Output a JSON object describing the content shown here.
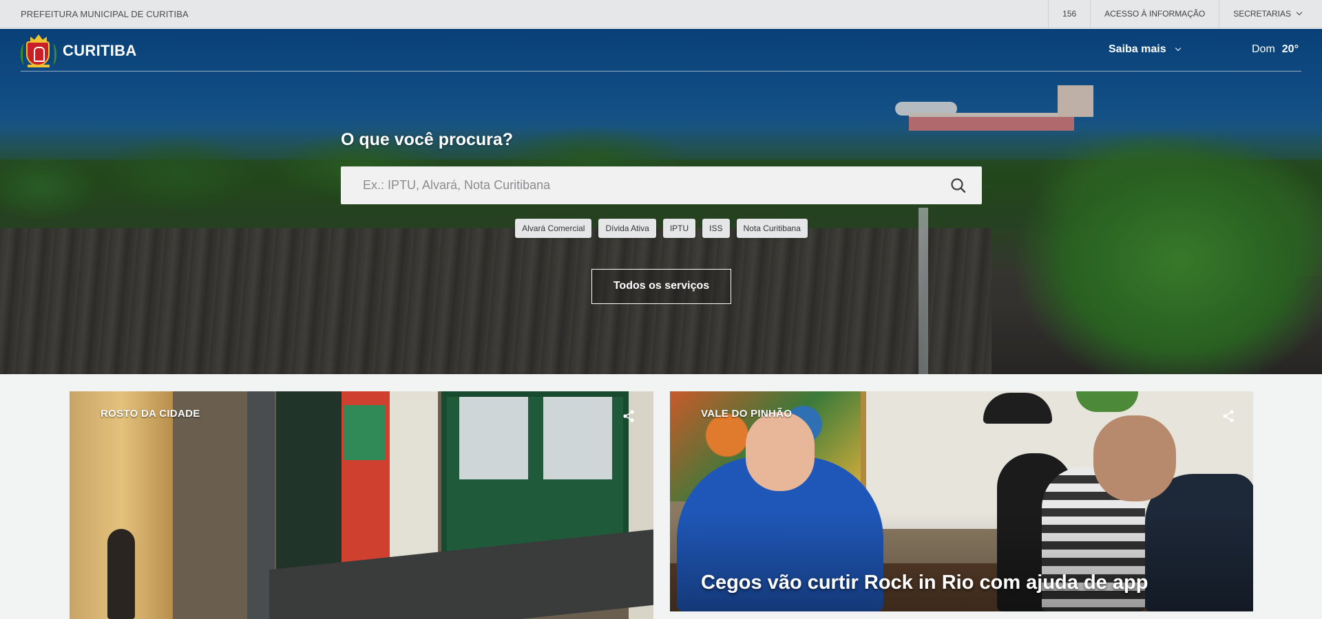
{
  "topbar": {
    "org_name": "PREFEITURA MUNICIPAL DE CURITIBA",
    "links": [
      "156",
      "ACESSO À INFORMAÇÃO",
      "SECRETARIAS"
    ]
  },
  "header": {
    "brand": "CURITIBA",
    "saiba_mais": "Saiba mais",
    "weather_day": "Dom",
    "weather_temp": "20°"
  },
  "search": {
    "title": "O que você procura?",
    "placeholder": "Ex.: IPTU, Alvará, Nota Curitibana",
    "chips": [
      "Alvará Comercial",
      "Dívida Ativa",
      "IPTU",
      "ISS",
      "Nota Curitibana"
    ],
    "all_services": "Todos os serviços"
  },
  "cards": [
    {
      "tag": "ROSTO DA CIDADE",
      "headline": ""
    },
    {
      "tag": "VALE DO PINHÃO",
      "headline": "Cegos vão curtir Rock in Rio com ajuda de app"
    }
  ],
  "icons": {
    "search": "search-icon",
    "share": "share-icon",
    "chevron": "chevron-down-icon",
    "logo": "coat-of-arms-logo"
  },
  "colors": {
    "topbar_bg": "#e6e7e8",
    "page_bg": "#f2f3f3",
    "search_bg": "#f1f1f2",
    "chip_bg": "#e5e6e7",
    "logo_red": "#c91f26",
    "logo_gold": "#f2c230"
  }
}
